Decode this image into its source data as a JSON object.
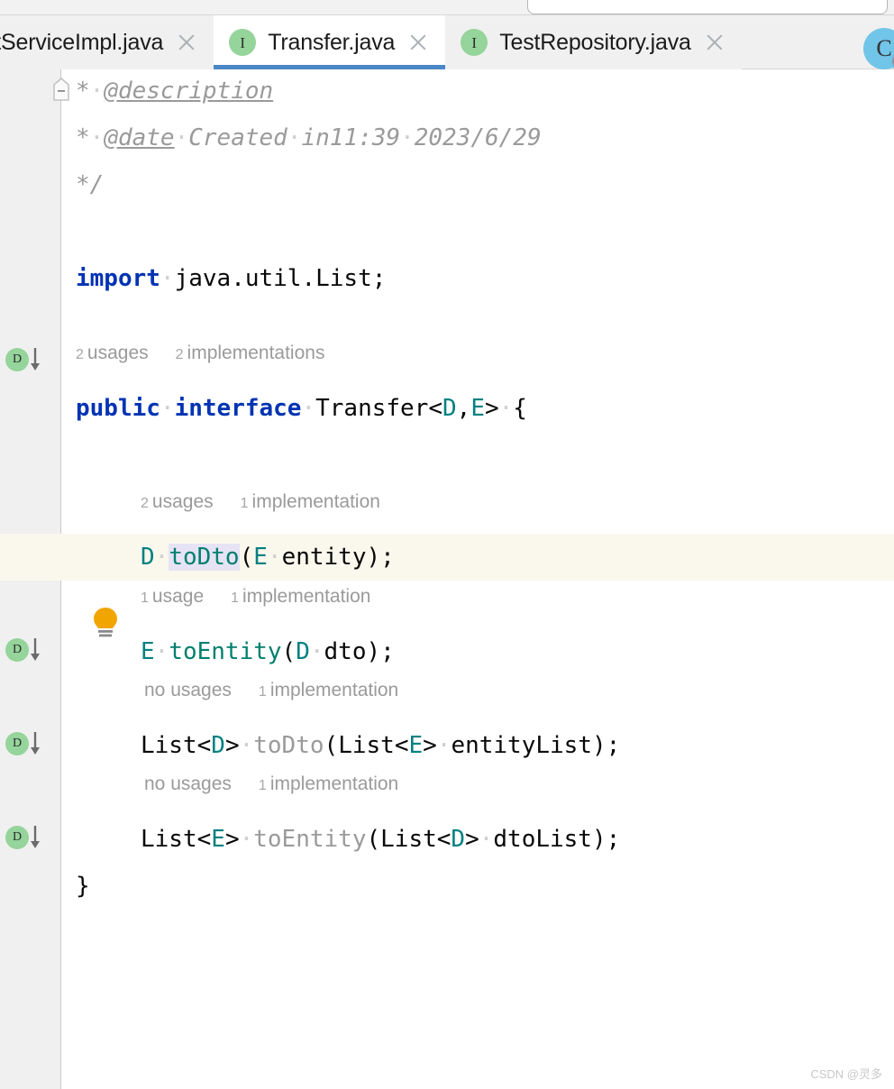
{
  "window": {
    "app": "IntelliJ IDEA",
    "toolbar": {
      "search_field_placeholder": ""
    }
  },
  "tabs": [
    {
      "label": "stServiceImpl.java",
      "icon": "interface-icon",
      "icon_glyph": "I",
      "selected": false,
      "truncated_left": true,
      "close_label": "×"
    },
    {
      "label": "Transfer.java",
      "icon": "interface-icon",
      "icon_glyph": "I",
      "selected": true,
      "truncated_left": false,
      "close_label": "×"
    },
    {
      "label": "TestRepository.java",
      "icon": "interface-icon",
      "icon_glyph": "I",
      "selected": false,
      "truncated_left": false,
      "close_label": "×"
    }
  ],
  "overflow_tab": {
    "icon": "class-icon",
    "icon_glyph": "C"
  },
  "colors": {
    "accent_tab_underline": "#4a88c7",
    "interface_icon_bg": "#95d49a",
    "class_icon_bg": "#71c5e8",
    "keyword": "#0033b3",
    "generic_type": "#008080",
    "method_name": "#00806e",
    "comment": "#9a9a9a",
    "caret_line_bg": "#faf8ed",
    "identifier_highlight_bg": "#e6e3f5",
    "gutter_bg": "#f0f0f0",
    "editor_bg": "#ffffff",
    "bulb": "#f0a500"
  },
  "editor": {
    "file": "Transfer.java",
    "javadoc": {
      "line_description": {
        "star": "*",
        "tag": "@description"
      },
      "line_date": {
        "star": "*",
        "tag": "@date",
        "text": "Created",
        "text2": "in11:39",
        "text3": "2023/6/29"
      },
      "line_close": "*/"
    },
    "import_line": {
      "keyword": "import",
      "path": "java.util.List;"
    },
    "interface_decl": {
      "hints": [
        {
          "count": "2",
          "label": "usages"
        },
        {
          "count": "2",
          "label": "implementations"
        }
      ],
      "modifier": "public",
      "keyword": "interface",
      "name": "Transfer",
      "generic_open": "<",
      "generic_params": [
        "D",
        "E"
      ],
      "generic_comma": ",",
      "generic_close": ">",
      "brace_open": "{",
      "gutter_icon": "implemented-by-icon"
    },
    "closing_brace": "}",
    "methods": [
      {
        "hints": [
          {
            "count": "2",
            "label": "usages"
          },
          {
            "count": "1",
            "label": "implementation"
          }
        ],
        "return_type": "D",
        "name": "toDto",
        "name_highlighted": true,
        "name_dimmed": false,
        "paren_open": "(",
        "param_type": "E",
        "param_name": "entity",
        "paren_close": ")",
        "semicolon": ";",
        "gutter_icon": "implemented-by-icon",
        "bulb_icon": "lightbulb-icon",
        "caret_line": true
      },
      {
        "hints": [
          {
            "count": "1",
            "label": "usage"
          },
          {
            "count": "1",
            "label": "implementation"
          }
        ],
        "return_type": "E",
        "name": "toEntity",
        "name_highlighted": false,
        "name_dimmed": false,
        "paren_open": "(",
        "param_type": "D",
        "param_name": "dto",
        "paren_close": ")",
        "semicolon": ";",
        "gutter_icon": "implemented-by-icon",
        "bulb_icon": null,
        "caret_line": false
      },
      {
        "hints": [
          {
            "count": "",
            "label": "no usages"
          },
          {
            "count": "1",
            "label": "implementation"
          }
        ],
        "return_type_raw": "List",
        "return_type_generic": "D",
        "name": "toDto",
        "name_highlighted": false,
        "name_dimmed": true,
        "paren_open": "(",
        "param_type_raw": "List",
        "param_type_generic": "E",
        "param_name": "entityList",
        "paren_close": ")",
        "semicolon": ";",
        "gutter_icon": "implemented-by-icon",
        "bulb_icon": null,
        "caret_line": false
      },
      {
        "hints": [
          {
            "count": "",
            "label": "no usages"
          },
          {
            "count": "1",
            "label": "implementation"
          }
        ],
        "return_type_raw": "List",
        "return_type_generic": "E",
        "name": "toEntity",
        "name_highlighted": false,
        "name_dimmed": true,
        "paren_open": "(",
        "param_type_raw": "List",
        "param_type_generic": "D",
        "param_name": "dtoList",
        "paren_close": ")",
        "semicolon": ";",
        "gutter_icon": "implemented-by-icon",
        "bulb_icon": null,
        "caret_line": false
      }
    ]
  },
  "watermark": "CSDN @灵多"
}
